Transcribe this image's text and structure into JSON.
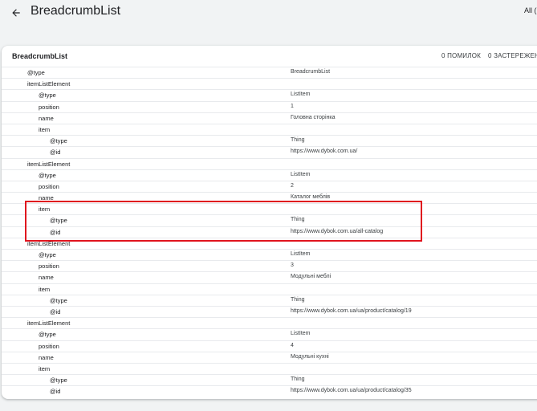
{
  "header": {
    "title": "BreadcrumbList",
    "filter_label": "All ("
  },
  "card": {
    "title": "BreadcrumbList",
    "errors": "0 ПОМИЛОК",
    "warnings": "0 ЗАСТЕРЕЖЕН"
  },
  "rows": [
    {
      "depth": 0,
      "key": "@type",
      "value": "BreadcrumbList"
    },
    {
      "depth": 0,
      "key": "itemListElement",
      "value": ""
    },
    {
      "depth": 1,
      "key": "@type",
      "value": "ListItem"
    },
    {
      "depth": 1,
      "key": "position",
      "value": "1"
    },
    {
      "depth": 1,
      "key": "name",
      "value": "Головна сторінка"
    },
    {
      "depth": 1,
      "key": "item",
      "value": ""
    },
    {
      "depth": 2,
      "key": "@type",
      "value": "Thing"
    },
    {
      "depth": 2,
      "key": "@id",
      "value": "https://www.dybok.com.ua/"
    },
    {
      "depth": 0,
      "key": "itemListElement",
      "value": ""
    },
    {
      "depth": 1,
      "key": "@type",
      "value": "ListItem"
    },
    {
      "depth": 1,
      "key": "position",
      "value": "2"
    },
    {
      "depth": 1,
      "key": "name",
      "value": "Каталог меблів"
    },
    {
      "depth": 1,
      "key": "item",
      "value": ""
    },
    {
      "depth": 2,
      "key": "@type",
      "value": "Thing"
    },
    {
      "depth": 2,
      "key": "@id",
      "value": "https://www.dybok.com.ua/all-catalog"
    },
    {
      "depth": 0,
      "key": "itemListElement",
      "value": ""
    },
    {
      "depth": 1,
      "key": "@type",
      "value": "ListItem"
    },
    {
      "depth": 1,
      "key": "position",
      "value": "3"
    },
    {
      "depth": 1,
      "key": "name",
      "value": "Модульні меблі"
    },
    {
      "depth": 1,
      "key": "item",
      "value": ""
    },
    {
      "depth": 2,
      "key": "@type",
      "value": "Thing"
    },
    {
      "depth": 2,
      "key": "@id",
      "value": "https://www.dybok.com.ua/ua/product/catalog/19"
    },
    {
      "depth": 0,
      "key": "itemListElement",
      "value": ""
    },
    {
      "depth": 1,
      "key": "@type",
      "value": "ListItem"
    },
    {
      "depth": 1,
      "key": "position",
      "value": "4"
    },
    {
      "depth": 1,
      "key": "name",
      "value": "Модульні кухні"
    },
    {
      "depth": 1,
      "key": "item",
      "value": ""
    },
    {
      "depth": 2,
      "key": "@type",
      "value": "Thing"
    },
    {
      "depth": 2,
      "key": "@id",
      "value": "https://www.dybok.com.ua/ua/product/catalog/35"
    }
  ],
  "colors": {
    "highlight": "#e0141e",
    "background": "#f1f3f4",
    "card": "#ffffff"
  },
  "icons": {
    "back": "arrow-back-icon"
  }
}
